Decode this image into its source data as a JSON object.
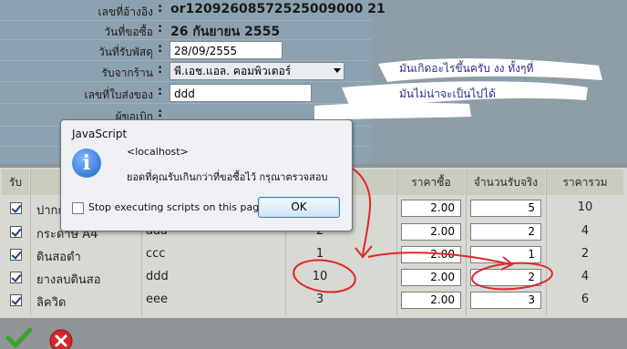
{
  "form": {
    "doc_no_label": "เลขที่อ้างอิง",
    "doc_no_value": "or12092608572525009000 21",
    "order_date_label": "วันที่ขอซื้อ",
    "order_date_value": "26 กันยายน 2555",
    "receive_date_label": "วันที่รับพัสดุ",
    "receive_date_value": "28/09/2555",
    "shop_label": "รับจากร้าน",
    "shop_value": "พี.เอช.แอล. คอมพิวเตอร์",
    "delivery_no_label": "เลขที่ใบส่งของ",
    "delivery_no_value": "ddd",
    "requester_label": "ผู้ขอเบิก"
  },
  "annotation": {
    "line1": "มันเกิดอะไรขึ้นครับ   งง   ทั้งๆที่",
    "line2": "มันไม่น่าจะเป็นไปได้"
  },
  "table": {
    "headers": {
      "receive": "รับ",
      "price": "ราคาซื้อ",
      "actual_qty": "จำนวนรับจริง",
      "total": "ราคารวม"
    },
    "rows": [
      {
        "name": "ปากกา",
        "code": "",
        "qty": "",
        "price": "2.00",
        "actual": "5",
        "total": "10"
      },
      {
        "name": "กระดาษ A4",
        "code": "aaa",
        "qty": "2",
        "price": "2.00",
        "actual": "2",
        "total": "4"
      },
      {
        "name": "ดินสอดำ",
        "code": "ccc",
        "qty": "1",
        "price": "2.00",
        "actual": "1",
        "total": "2"
      },
      {
        "name": "ยางลบดินสอ",
        "code": "ddd",
        "qty": "10",
        "price": "2.00",
        "actual": "2",
        "total": "4"
      },
      {
        "name": "ลิควิด",
        "code": "eee",
        "qty": "3",
        "price": "2.00",
        "actual": "3",
        "total": "6"
      }
    ]
  },
  "dialog": {
    "title": "JavaScript",
    "host": "<localhost>",
    "message": "ยอดที่คุณรับเกินกว่าที่ขอซื้อไว้ กรุณาตรวจสอบ",
    "checkbox_label": "Stop executing scripts on this page",
    "ok_label": "OK",
    "icon": "info-icon"
  },
  "colors": {
    "annotation_red": "#e0262a",
    "annotation_text": "#2b2b8a"
  }
}
